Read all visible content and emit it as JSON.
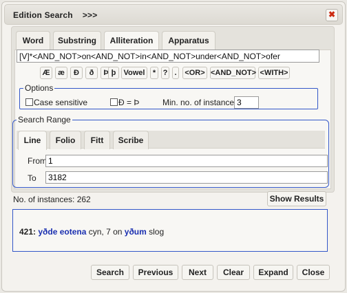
{
  "dialog": {
    "title": "Edition Search",
    "title_arrows": ">>>",
    "close_glyph": "✖"
  },
  "main_tabs": [
    {
      "label": "Word",
      "active": false
    },
    {
      "label": "Substring",
      "active": false
    },
    {
      "label": "Alliteration",
      "active": true
    },
    {
      "label": "Apparatus",
      "active": false
    }
  ],
  "query": {
    "value": "[V]*<AND_NOT>on<AND_NOT>in<AND_NOT>under<AND_NOT>ofer"
  },
  "keyboard": [
    "Æ",
    "æ",
    "Ð",
    "ð",
    "Þ",
    "þ",
    "Vowel",
    "*",
    "?",
    ".",
    "<OR>",
    "<AND_NOT>",
    "<WITH>"
  ],
  "options": {
    "legend": "Options",
    "case_sensitive_label": "Case sensitive",
    "case_sensitive_checked": false,
    "eth_thorn_label": "Ð = Þ",
    "eth_thorn_checked": false,
    "min_instances_label": "Min. no. of instances",
    "min_instances_value": "3"
  },
  "search_range": {
    "legend": "Search Range",
    "tabs": [
      {
        "label": "Line",
        "active": true
      },
      {
        "label": "Folio",
        "active": false
      },
      {
        "label": "Fitt",
        "active": false
      },
      {
        "label": "Scribe",
        "active": false
      }
    ],
    "from_label": "From",
    "from_value": "1",
    "to_label": "To",
    "to_value": "3182"
  },
  "status": {
    "instances_text": "No. of instances: 262"
  },
  "show_results_label": "Show Results",
  "result": {
    "line_number": "421:",
    "word1": "yðde eotena",
    "text1": " cyn, 7 on ",
    "word2": "yðum",
    "text2": " slog"
  },
  "buttons": {
    "search": "Search",
    "previous": "Previous",
    "next": "Next",
    "clear": "Clear",
    "expand": "Expand",
    "close": "Close"
  },
  "colors": {
    "accent_border": "#3256c8",
    "highlight_text": "#1a2fb0",
    "close_icon": "#cc2b12"
  }
}
